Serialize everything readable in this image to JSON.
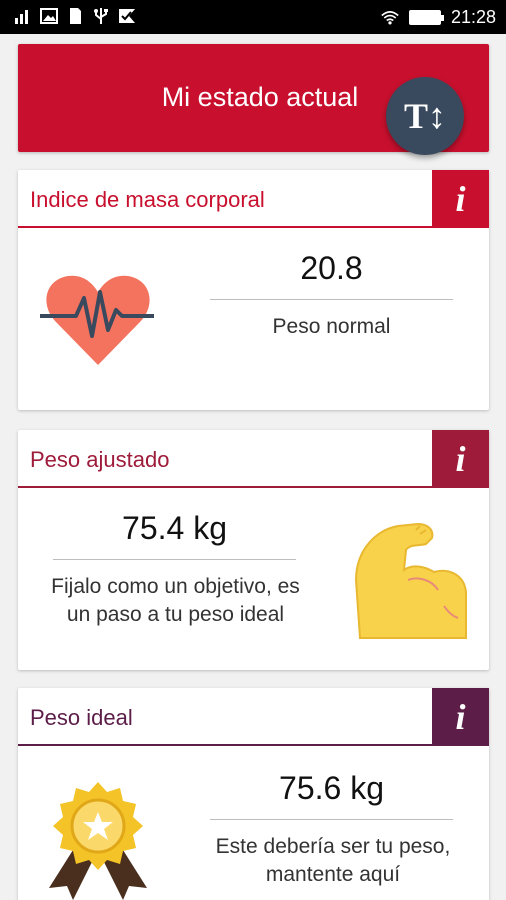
{
  "status_bar": {
    "time": "21:28",
    "left_icons": [
      "signal-icon",
      "image-icon",
      "sim-icon",
      "usb-icon",
      "check-icon"
    ],
    "right_icons": [
      "wifi-icon",
      "battery-icon"
    ]
  },
  "header": {
    "title": "Mi estado actual",
    "fab_label": "T↕"
  },
  "cards": [
    {
      "title": "Indice de masa corporal",
      "info": "i",
      "value": "20.8",
      "caption": "Peso normal",
      "icon": "heartbeat-icon"
    },
    {
      "title": "Peso ajustado",
      "info": "i",
      "value": "75.4 kg",
      "caption_line1": "Fijalo como un objetivo, es",
      "caption_line2": "un paso a tu peso ideal",
      "icon": "flexed-arm-icon"
    },
    {
      "title": "Peso ideal",
      "info": "i",
      "value": "75.6 kg",
      "caption_line1": "Este debería ser tu peso,",
      "caption_line2": "mantente aquí",
      "icon": "award-medal-icon"
    }
  ],
  "colors": {
    "primary": "#c8102e",
    "card2_accent": "#9e1b3a",
    "card3_accent": "#5c1e48",
    "fab": "#3a4a5e"
  }
}
